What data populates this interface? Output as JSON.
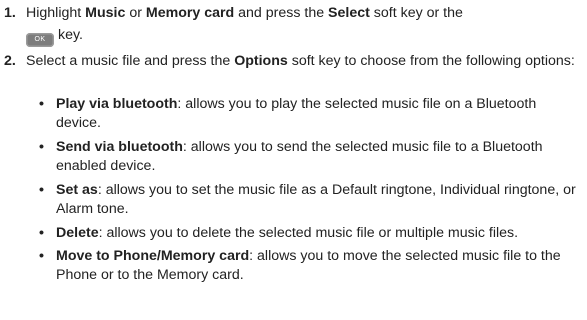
{
  "steps": [
    {
      "number": "1.",
      "line1": {
        "pre": "Highlight ",
        "b1": "Music",
        "mid1": " or ",
        "b2": "Memory card",
        "mid2": " and press the ",
        "b3": "Select",
        "post": " soft key or the"
      },
      "line2": {
        "key_label": "OK",
        "post": "key."
      }
    },
    {
      "number": "2.",
      "pre": "Select a music file and press the ",
      "bold": "Options",
      "post": " soft key to choose from the following options:"
    }
  ],
  "options": [
    {
      "term": "Play via bluetooth",
      "desc": ": allows you to play the selected music file on a Bluetooth device."
    },
    {
      "term": "Send via bluetooth",
      "desc": ": allows you to send the selected music file to a Bluetooth enabled device."
    },
    {
      "term": "Set as",
      "desc": ": allows you to set the music file as a Default ringtone, Individual ringtone, or Alarm tone."
    },
    {
      "term": "Delete",
      "desc": ": allows you to delete the selected music file or multiple music files."
    },
    {
      "term": "Move to Phone/Memory card",
      "desc": ": allows you to move the selected music file to the Phone or to the Memory card."
    }
  ],
  "bullet_char": "•"
}
